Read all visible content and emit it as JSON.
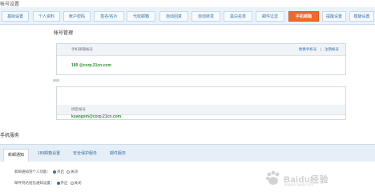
{
  "page": {
    "section_title": "帐号设置"
  },
  "top_tabs": [
    {
      "label": "基础设置",
      "active": false
    },
    {
      "label": "个人资料",
      "active": false
    },
    {
      "label": "帐户密码",
      "active": false
    },
    {
      "label": "签名/名片",
      "active": false
    },
    {
      "label": "代收邮箱",
      "active": false
    },
    {
      "label": "自动回复",
      "active": false
    },
    {
      "label": "自动转发",
      "active": false
    },
    {
      "label": "黑白名单",
      "active": false
    },
    {
      "label": "邮件过滤",
      "active": false
    },
    {
      "label": "手机邮箱",
      "active": true
    },
    {
      "label": "提醒设置",
      "active": false
    },
    {
      "label": "模版设置",
      "active": false
    }
  ],
  "account_management": {
    "heading": "帐号管理",
    "mobile_card": {
      "label": "手机邮箱帐号",
      "value": "189         @corp.21cn.com",
      "actions": [
        "更换手机号",
        "注销帐号"
      ]
    },
    "bound_card": {
      "label": "绑定帐号",
      "value": "kuangsm@corp.21cn.com"
    }
  },
  "mobile_service": {
    "title": "手机服务",
    "sub_tabs": [
      {
        "label": "新邮通知",
        "active": true
      },
      {
        "label": "189邮箱设置",
        "active": false
      },
      {
        "label": "安全保护服务",
        "active": false
      },
      {
        "label": "邮件服务",
        "active": false
      }
    ],
    "rows": [
      {
        "label": "新邮通知到个人功能：",
        "options": [
          "开启",
          "关闭"
        ],
        "selected": 0
      },
      {
        "label": "邮件到达短信通知设置：",
        "options": [
          "开启",
          "关闭"
        ],
        "selected": 0
      }
    ]
  },
  "watermark": {
    "brand": "Baidu经验",
    "sub": "jingyan.baidu.com"
  }
}
